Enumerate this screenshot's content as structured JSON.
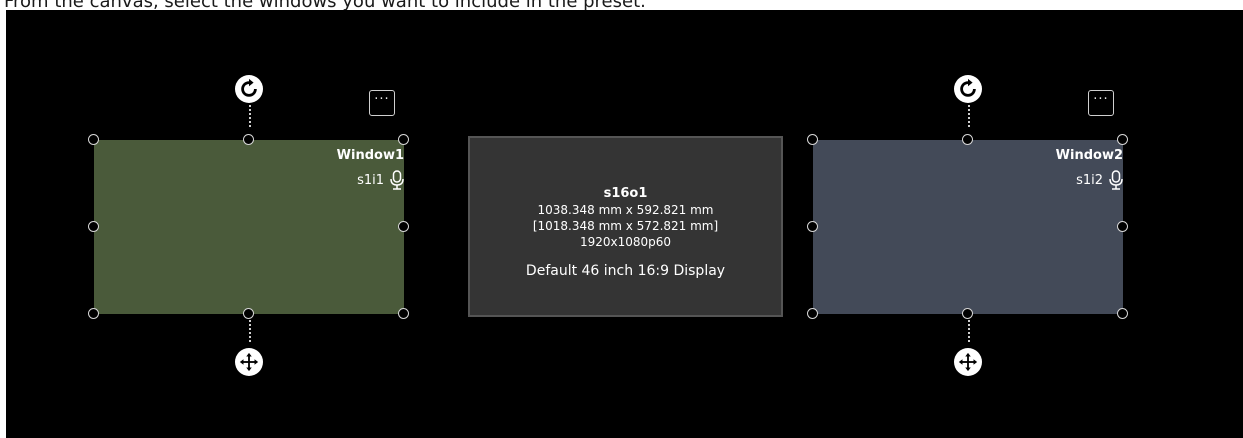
{
  "instruction": "From the canvas, select the windows you want to include in the preset.",
  "colors": {
    "canvas": "#000000",
    "window1_fill": "#4a5a3a",
    "window2_fill": "#434a58",
    "display_fill": "#343434"
  },
  "windows": [
    {
      "title": "Window1",
      "input": "s1i1",
      "rotate_icon": "rotate-icon",
      "move_icon": "move-icon",
      "more_label": "···"
    },
    {
      "title": "Window2",
      "input": "s1i2",
      "rotate_icon": "rotate-icon",
      "move_icon": "move-icon",
      "more_label": "···"
    }
  ],
  "display": {
    "name": "s16o1",
    "size": "1038.348 mm x 592.821 mm",
    "viewable": "[1018.348 mm x 572.821 mm]",
    "resolution": "1920x1080p60",
    "description": "Default 46 inch 16:9 Display"
  }
}
